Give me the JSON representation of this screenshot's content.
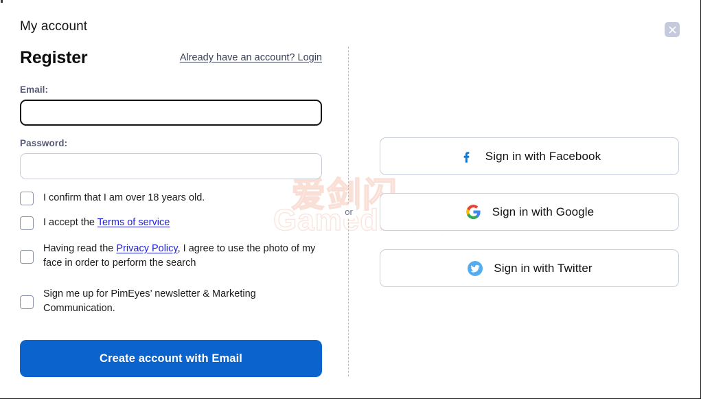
{
  "header": {
    "title": "My account",
    "close_icon": "close-icon"
  },
  "register": {
    "heading": "Register",
    "login_link": "Already have an account? Login",
    "email_label": "Email:",
    "email_value": "",
    "email_placeholder": "",
    "password_label": "Password:",
    "password_value": "",
    "password_placeholder": "",
    "submit_label": "Create account with Email",
    "consents": [
      {
        "id": "age",
        "text_before": "I confirm that I am over 18 years old.",
        "link": "",
        "text_after": "",
        "checked": false
      },
      {
        "id": "terms",
        "text_before": "I accept the ",
        "link": "Terms of service",
        "text_after": "",
        "checked": false
      },
      {
        "id": "privacy",
        "text_before": "Having read the ",
        "link": "Privacy Policy",
        "text_after": ", I agree to use the photo of my face in order to perform the search",
        "checked": false
      },
      {
        "id": "newsletter",
        "text_before": "Sign me up for PimEyes’ newsletter & Marketing Communication.",
        "link": "",
        "text_after": "",
        "checked": false
      }
    ]
  },
  "divider": {
    "label": "or"
  },
  "social": {
    "buttons": [
      {
        "id": "facebook",
        "label": "Sign in with Facebook",
        "icon": "facebook-icon",
        "color": "#1877d1"
      },
      {
        "id": "google",
        "label": "Sign in with Google",
        "icon": "google-icon",
        "color": "#4285f4"
      },
      {
        "id": "twitter",
        "label": "Sign in with Twitter",
        "icon": "twitter-icon",
        "color": "#55acee"
      }
    ]
  },
  "watermark": {
    "line1": "爱剑闪",
    "line2": "Gamedivert"
  },
  "colors": {
    "primary": "#0b63ce",
    "link": "#1f1fd6",
    "muted_link": "#3b4059",
    "label": "#565b74",
    "border_light": "#c8cde0",
    "close_bg": "#c6cadd"
  }
}
